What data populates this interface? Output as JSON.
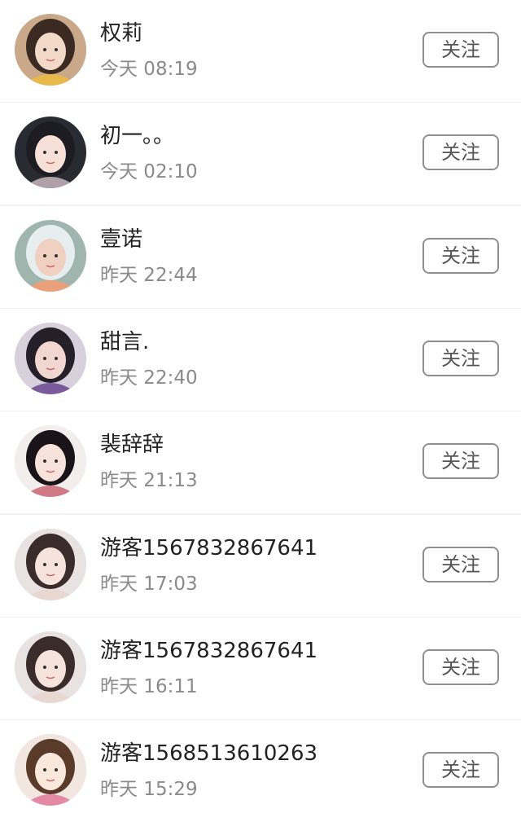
{
  "follow_label": "关注",
  "users": [
    {
      "name": "权莉",
      "time": "今天 08:19",
      "avatar_icon": "avatar-photo-1",
      "bg": "#c9a98a",
      "skin": "#f3d9c8",
      "hair": "#3a2a22",
      "accent": "#e8b84a"
    },
    {
      "name": "初一。。",
      "time": "今天 02:10",
      "avatar_icon": "avatar-photo-2",
      "bg": "#2a2a32",
      "skin": "#f6e0d8",
      "hair": "#1c1c22",
      "accent": "#b0a0a8"
    },
    {
      "name": "壹诺",
      "time": "昨天 22:44",
      "avatar_icon": "avatar-photo-3",
      "bg": "#9fb5ad",
      "skin": "#f0d0c0",
      "hair": "#e7eef0",
      "accent": "#e9a079"
    },
    {
      "name": "甜言.",
      "time": "昨天 22:40",
      "avatar_icon": "avatar-photo-4",
      "bg": "#d8d0dc",
      "skin": "#f1d7cf",
      "hair": "#241f28",
      "accent": "#7a5a9a"
    },
    {
      "name": "裴辞辞",
      "time": "昨天 21:13",
      "avatar_icon": "avatar-photo-5",
      "bg": "#f2eeee",
      "skin": "#f7e3dc",
      "hair": "#1a1418",
      "accent": "#d07a86"
    },
    {
      "name": "游客1567832867641",
      "time": "昨天 17:03",
      "avatar_icon": "avatar-photo-6",
      "bg": "#e8e2e2",
      "skin": "#f5e3dc",
      "hair": "#3a2c2a",
      "accent": "#e9d7d2"
    },
    {
      "name": "游客1567832867641",
      "time": "昨天 16:11",
      "avatar_icon": "avatar-photo-7",
      "bg": "#e8e2e2",
      "skin": "#f5e3dc",
      "hair": "#3a2c2a",
      "accent": "#e9d7d2"
    },
    {
      "name": "游客1568513610263",
      "time": "昨天 15:29",
      "avatar_icon": "avatar-photo-8",
      "bg": "#f1e6e0",
      "skin": "#fbe8dc",
      "hair": "#5a3b2a",
      "accent": "#e48aa6"
    }
  ]
}
